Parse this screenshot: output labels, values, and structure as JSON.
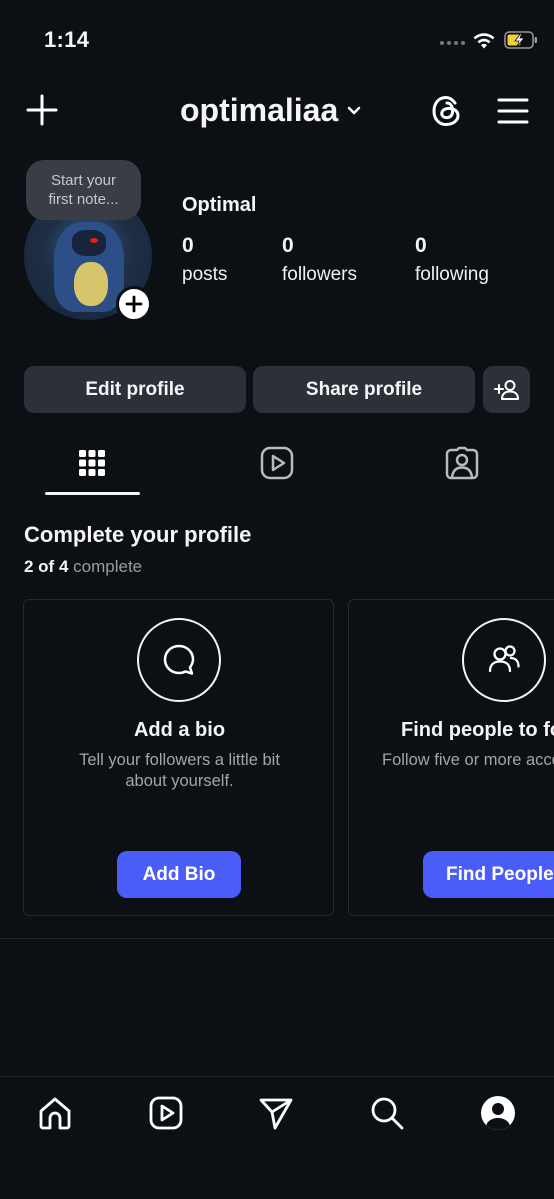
{
  "status_bar": {
    "time": "1:14"
  },
  "header": {
    "username": "optimaliaa"
  },
  "profile": {
    "note_placeholder": "Start your\nfirst note...",
    "display_name": "Optimal",
    "stats": [
      {
        "value": "0",
        "label": "posts"
      },
      {
        "value": "0",
        "label": "followers"
      },
      {
        "value": "0",
        "label": "following"
      }
    ]
  },
  "actions": {
    "edit_label": "Edit profile",
    "share_label": "Share profile"
  },
  "tabs": [
    {
      "icon": "grid-icon",
      "active": true
    },
    {
      "icon": "reels-icon",
      "active": false
    },
    {
      "icon": "tagged-icon",
      "active": false
    }
  ],
  "complete_profile": {
    "title": "Complete your profile",
    "progress_count": "2 of 4",
    "progress_suffix": "complete",
    "cards": [
      {
        "icon": "chat-bubble-icon",
        "title": "Add a bio",
        "description": "Tell your followers a little bit\nabout yourself.",
        "button": "Add Bio"
      },
      {
        "icon": "people-icon",
        "title": "Find people to follow",
        "description": "Follow five or more accounts.",
        "button": "Find People"
      }
    ]
  },
  "bottom_nav": [
    "home-icon",
    "reels-icon",
    "direct-icon",
    "search-icon",
    "profile-icon"
  ],
  "colors": {
    "background": "#0c0f14",
    "button": "#2c3038",
    "accent": "#4a5df9"
  }
}
